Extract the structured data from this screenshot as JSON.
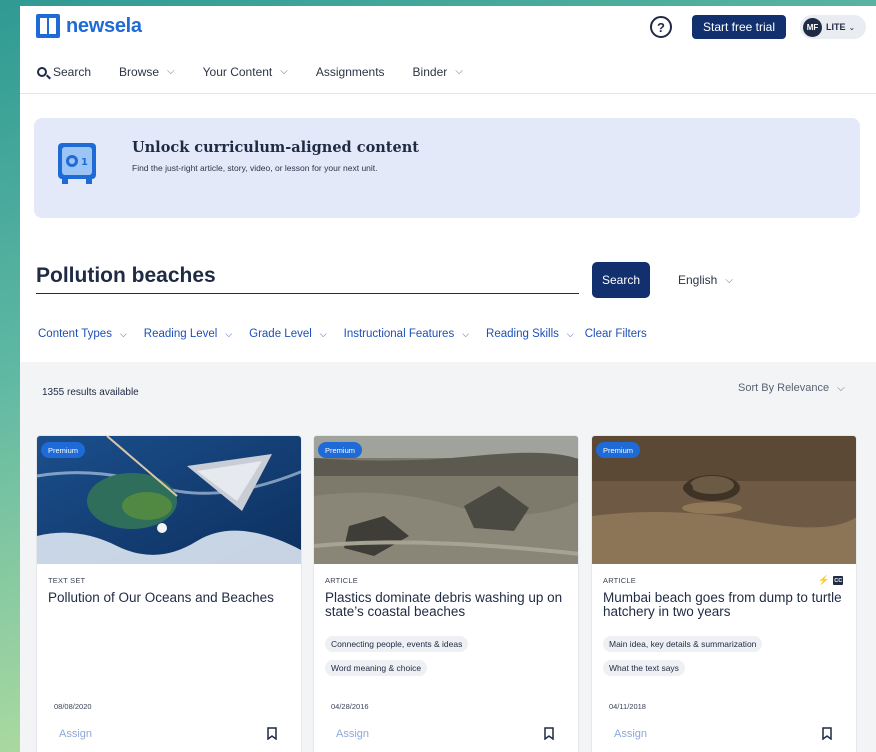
{
  "header": {
    "logo_text": "newsela",
    "help_glyph": "?",
    "trial_button": "Start free trial",
    "user_initials": "MF",
    "user_plan": "LITE",
    "caret": "⌄"
  },
  "nav": {
    "search_label": "Search",
    "items": [
      {
        "label": "Browse",
        "chevron": "⌵"
      },
      {
        "label": "Your Content",
        "chevron": "⌵"
      },
      {
        "label": "Assignments",
        "chevron": ""
      },
      {
        "label": "Binder",
        "chevron": "⌵"
      }
    ]
  },
  "banner": {
    "title": "Unlock curriculum-aligned content",
    "subtitle": "Find the just-right article, story, video, or lesson for your next unit.",
    "icon": "safe-icon"
  },
  "search": {
    "query": "Pollution beaches",
    "button": "Search",
    "language": "English",
    "chevron": "⌵"
  },
  "filters": {
    "items": [
      "Content Types",
      "Reading Level",
      "Grade Level",
      "Instructional Features",
      "Reading Skills"
    ],
    "clear": "Clear Filters",
    "chevron": "⌵"
  },
  "results": {
    "count": "1355 results available",
    "sort": "Sort By Relevance",
    "chevron": "⌵",
    "cards": [
      {
        "badge": "Premium",
        "type": "TEXT SET",
        "title": "Pollution of Our Oceans and Beaches",
        "skills": [],
        "date": "08/08/2020",
        "assign": "Assign"
      },
      {
        "badge": "Premium",
        "type": "ARTICLE",
        "title": "Plastics dominate debris washing up on state’s coastal beaches",
        "skills": [
          "Connecting people, events & ideas",
          "Word meaning & choice"
        ],
        "date": "04/28/2016",
        "assign": "Assign"
      },
      {
        "badge": "Premium",
        "type": "ARTICLE",
        "title": "Mumbai beach goes from dump to turtle hatchery in two years",
        "skills": [
          "Main idea, key details & summarization",
          "What the text says"
        ],
        "date": "04/11/2018",
        "assign": "Assign",
        "bolt": "⚡",
        "cc": "CC"
      }
    ]
  },
  "colors": {
    "brand": "#1e6ad6",
    "navy_button": "#12306e",
    "banner_bg": "#e4e9f9",
    "link": "#1e4fb8"
  }
}
